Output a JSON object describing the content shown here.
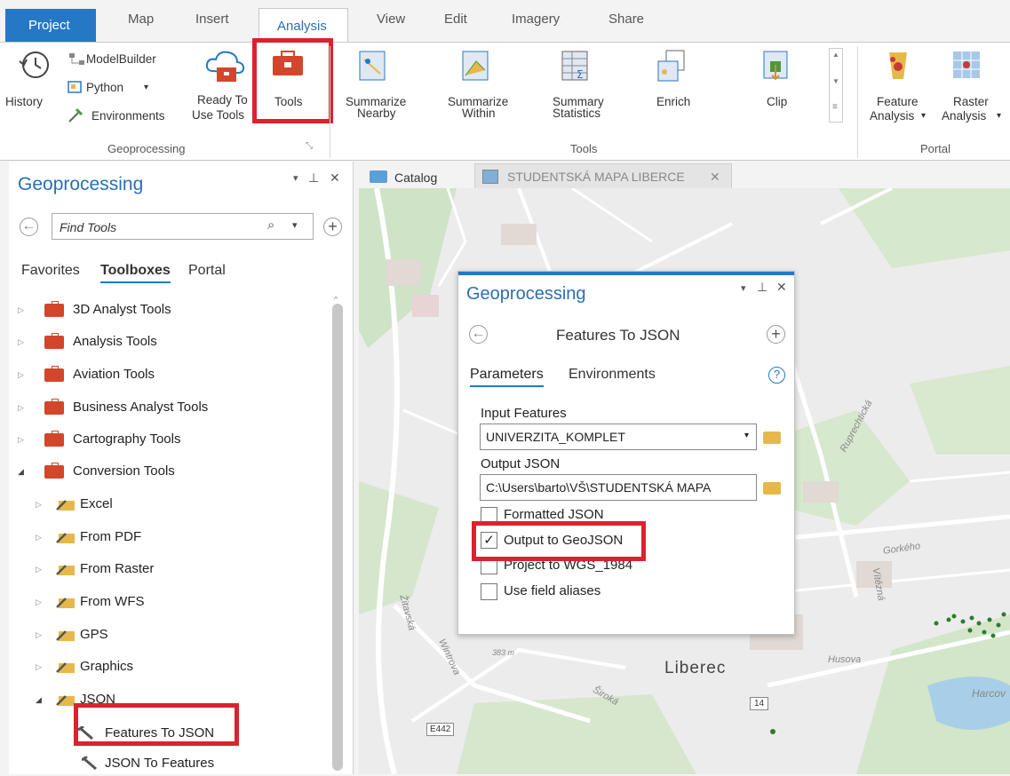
{
  "ribbon": {
    "tabs": [
      "Project",
      "Map",
      "Insert",
      "Analysis",
      "View",
      "Edit",
      "Imagery",
      "Share"
    ],
    "active_tab": "Analysis",
    "geoprocessing": {
      "history": "History",
      "modelbuilder": "ModelBuilder",
      "python": "Python",
      "environments": "Environments",
      "ready_to_use_line1": "Ready To",
      "ready_to_use_line2": "Use Tools",
      "tools": "Tools",
      "group_label": "Geoprocessing"
    },
    "tools_group": {
      "items": [
        {
          "line1": "Summarize",
          "line2": "Nearby"
        },
        {
          "line1": "Summarize",
          "line2": "Within"
        },
        {
          "line1": "Summary",
          "line2": "Statistics"
        },
        {
          "line1": "Enrich",
          "line2": ""
        },
        {
          "line1": "Clip",
          "line2": ""
        }
      ],
      "group_label": "Tools"
    },
    "portal": {
      "feature_line1": "Feature",
      "feature_line2": "Analysis",
      "raster_line1": "Raster",
      "raster_line2": "Analysis",
      "group_label": "Portal"
    }
  },
  "left_pane": {
    "title": "Geoprocessing",
    "search_placeholder": "Find Tools",
    "subtabs": [
      "Favorites",
      "Toolboxes",
      "Portal"
    ],
    "active_subtab": "Toolboxes",
    "toolboxes": [
      "3D Analyst Tools",
      "Analysis Tools",
      "Aviation Tools",
      "Business Analyst Tools",
      "Cartography Tools",
      "Conversion Tools"
    ],
    "toolsets": [
      "Excel",
      "From PDF",
      "From Raster",
      "From WFS",
      "GPS",
      "Graphics",
      "JSON"
    ],
    "tools": [
      "Features To JSON",
      "JSON To Features"
    ]
  },
  "map_tabs": {
    "catalog": "Catalog",
    "map": "STUDENTSKÁ MAPA LIBERCE"
  },
  "map_labels": {
    "city": "Liberec",
    "streets": [
      "Ruprechtická",
      "Gorkého",
      "Vítězná",
      "Husova",
      "Žitavská",
      "Wintrova",
      "Široká",
      "Harcov"
    ],
    "elevation": "383 m",
    "road_e442": "E442",
    "road_14": "14"
  },
  "dialog": {
    "title": "Geoprocessing",
    "tool_name": "Features To JSON",
    "tabs": [
      "Parameters",
      "Environments"
    ],
    "input_label": "Input Features",
    "input_value": "UNIVERZITA_KOMPLET",
    "output_label": "Output JSON",
    "output_value": "C:\\Users\\barto\\VŠ\\STUDENTSKÁ MAPA",
    "checkboxes": [
      {
        "label": "Formatted JSON",
        "checked": false
      },
      {
        "label": "Output to GeoJSON",
        "checked": true
      },
      {
        "label": "Project to WGS_1984",
        "checked": false
      },
      {
        "label": "Use field aliases",
        "checked": false
      }
    ]
  },
  "colors": {
    "accent": "#2578c4",
    "highlight": "#d9232e",
    "toolbox": "#d2462c"
  }
}
